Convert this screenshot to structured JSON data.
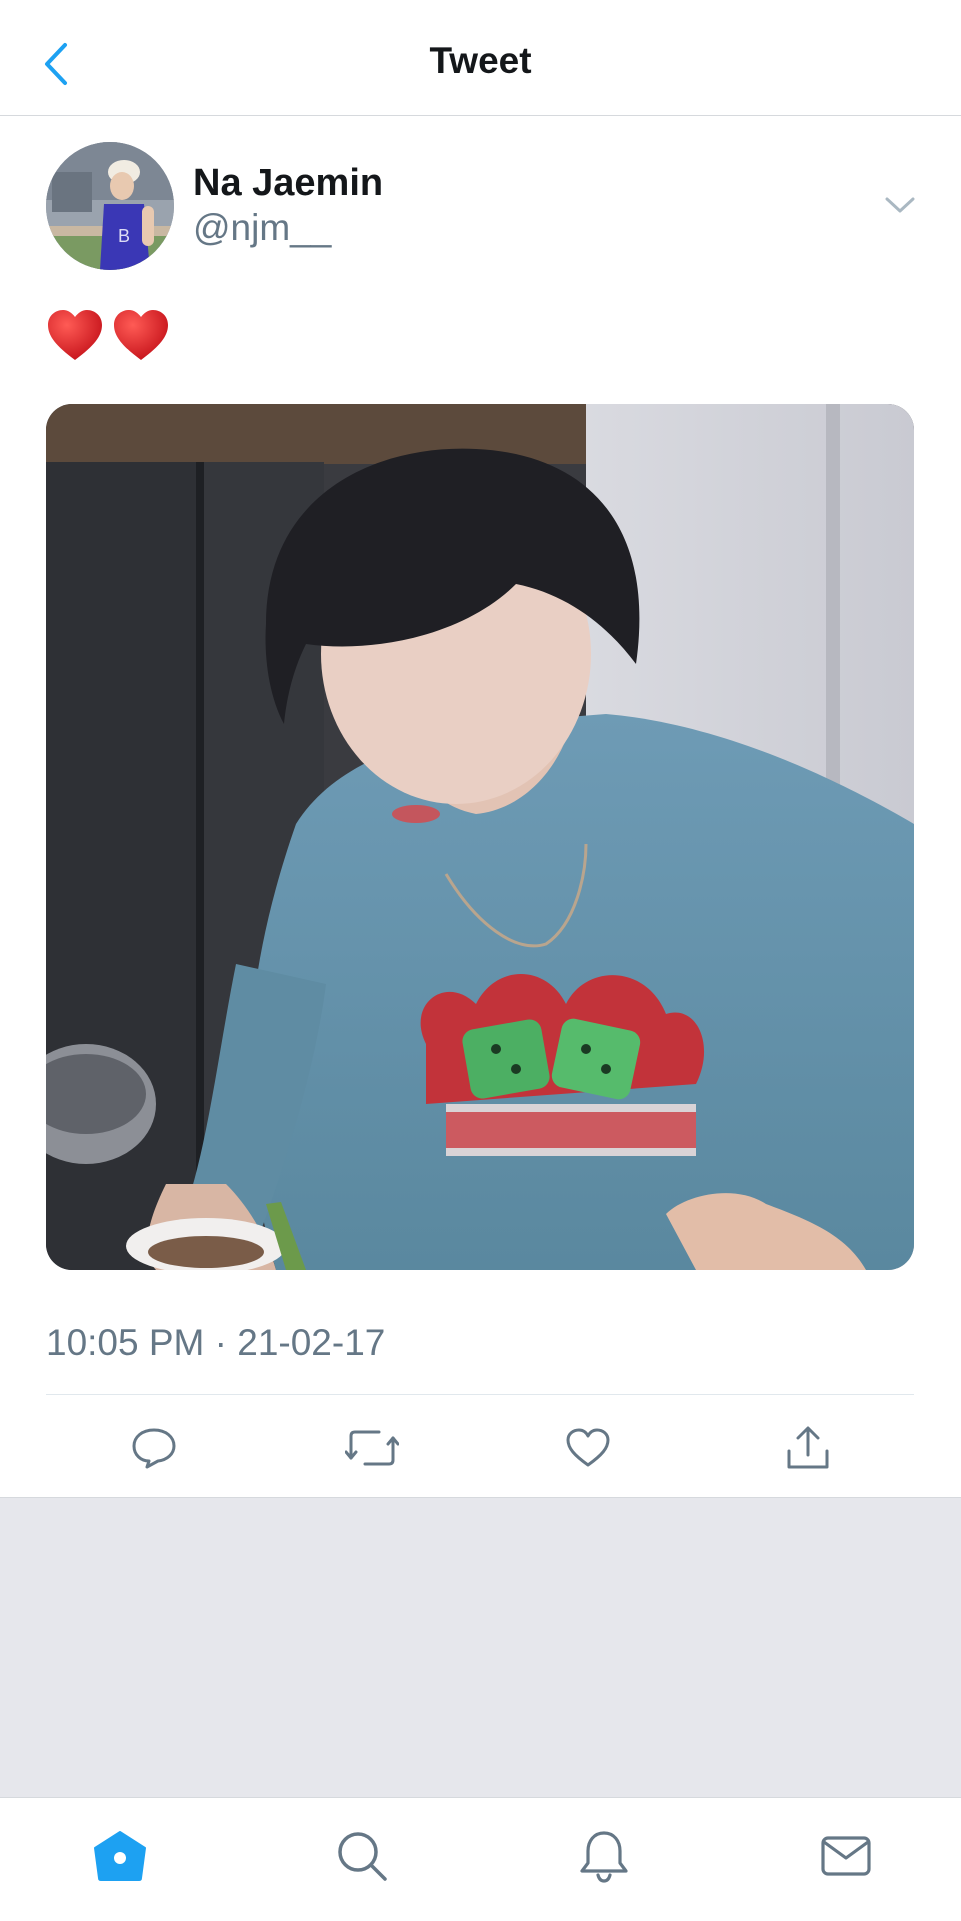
{
  "header": {
    "title": "Tweet",
    "back_icon": "chevron-left-icon"
  },
  "tweet": {
    "author_name": "Na Jaemin",
    "author_handle": "@njm__",
    "text_emojis": [
      "red-heart",
      "red-heart"
    ],
    "timestamp": "10:05 PM · 21-02-17",
    "actions": [
      "reply-icon",
      "retweet-icon",
      "like-icon",
      "share-icon"
    ]
  },
  "tab_bar": {
    "tabs": [
      "home-icon",
      "search-icon",
      "notifications-icon",
      "messages-icon"
    ],
    "active": "home-icon"
  },
  "colors": {
    "accent": "#1da1f2",
    "icon_gray": "#657786",
    "empty_area": "#e6e7ec"
  }
}
